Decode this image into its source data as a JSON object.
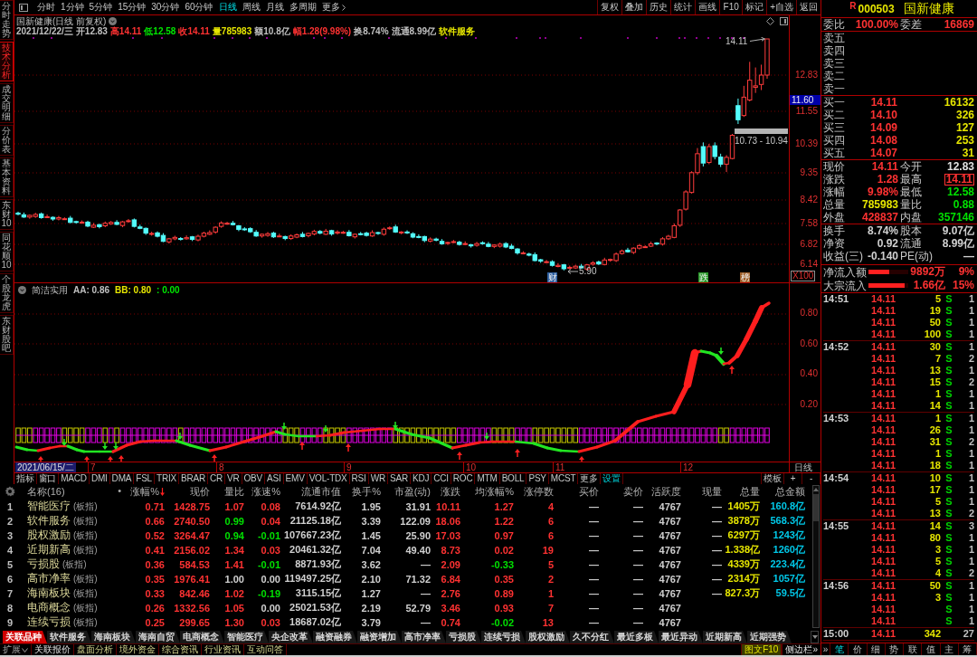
{
  "side_tabs": [
    {
      "label": "分时走势",
      "selected": false
    },
    {
      "label": "技术分析",
      "selected": true
    },
    {
      "label": "成交明细",
      "selected": false
    },
    {
      "label": "分价表",
      "selected": false
    },
    {
      "label": "基本资料",
      "selected": false
    },
    {
      "label": "东财10",
      "selected": false
    },
    {
      "label": "同花顺10",
      "selected": false
    },
    {
      "label": "个股龙虎",
      "selected": false
    },
    {
      "label": "东财股吧",
      "selected": false
    }
  ],
  "toolbar": {
    "periods": [
      {
        "label": "分时",
        "selected": false
      },
      {
        "label": "1分钟",
        "selected": false
      },
      {
        "label": "5分钟",
        "selected": false
      },
      {
        "label": "15分钟",
        "selected": false
      },
      {
        "label": "30分钟",
        "selected": false
      },
      {
        "label": "60分钟",
        "selected": false
      },
      {
        "label": "日线",
        "selected": true
      },
      {
        "label": "周线",
        "selected": false
      },
      {
        "label": "月线",
        "selected": false
      },
      {
        "label": "多周期",
        "selected": false
      }
    ],
    "more": "更多",
    "actions": [
      "复权",
      "叠加",
      "历史",
      "统计",
      "画线",
      "F10",
      "标记",
      "+自选",
      "返回"
    ]
  },
  "chart": {
    "title": "国新健康(日线 前复权)",
    "info": [
      {
        "text": "2021/12/22/三",
        "color": "#c0c0c0"
      },
      {
        "text": "开12.83",
        "color": "#c0c0c0"
      },
      {
        "text": "高14.11",
        "color": "#ff3232"
      },
      {
        "text": "低12.58",
        "color": "#00e600"
      },
      {
        "text": "收14.11",
        "color": "#ff3232"
      },
      {
        "text": "量785983",
        "color": "#e6e600"
      },
      {
        "text": "额10.8亿",
        "color": "#c0c0c0"
      },
      {
        "text": "幅1.28(9.98%)",
        "color": "#ff3232"
      },
      {
        "text": "换8.74%",
        "color": "#c0c0c0"
      },
      {
        "text": "流通8.99亿",
        "color": "#c0c0c0"
      },
      {
        "text": "软件服务",
        "color": "#e6e600"
      }
    ],
    "high_label": "14.11",
    "range_label": "10.73 - 10.94",
    "low_label": "5.90",
    "badges": [
      {
        "text": "财",
        "color": "#2d5fa0"
      },
      {
        "text": "跌",
        "color": "#2a9a2a"
      },
      {
        "text": "榜",
        "color": "#a0602a"
      }
    ],
    "price_axis": [
      "12.83",
      "11.55",
      "10.39",
      "9.35",
      "8.42",
      "7.58",
      "6.82",
      "6.14"
    ],
    "price_tag": "11.60",
    "scale": "X100"
  },
  "indicator": {
    "name": "简洁实用",
    "values": [
      {
        "text": "AA: 0.86",
        "color": "#c0c0c0"
      },
      {
        "text": "BB: 0.80",
        "color": "#e6e600"
      },
      {
        "text": ": 0.00",
        "color": "#00e600"
      }
    ],
    "axis": [
      "0.80",
      "0.60",
      "0.40",
      "0.20"
    ]
  },
  "time_axis": {
    "cursor_date": "2021/06/15/二",
    "months": [
      "7",
      "8",
      "9",
      "10",
      "11",
      "12"
    ],
    "period": "日线"
  },
  "indicator_tabs": {
    "tabs": [
      "指标",
      "窗口",
      "MACD",
      "DMI",
      "DMA",
      "FSL",
      "TRIX",
      "BRAR",
      "CR",
      "VR",
      "OBV",
      "ASI",
      "EMV",
      "VOL-TDX",
      "RSI",
      "WR",
      "SAR",
      "KDJ",
      "CCI",
      "ROC",
      "MTM",
      "BOLL",
      "PSY",
      "MCST"
    ],
    "more": "更多",
    "settings": "设置",
    "template": "模板",
    "zoom_in": "+",
    "zoom_out": "-"
  },
  "table": {
    "name_header": "名称(16)",
    "marker_header": "•",
    "columns": [
      {
        "label": "涨幅%",
        "sorted": true
      },
      {
        "label": "现价",
        "sorted": false
      },
      {
        "label": "量比",
        "sorted": false
      },
      {
        "label": "涨速%",
        "sorted": false
      },
      {
        "label": "流通市值",
        "sorted": false
      },
      {
        "label": "换手%",
        "sorted": false
      },
      {
        "label": "市盈(动)",
        "sorted": false
      },
      {
        "label": "涨跌",
        "sorted": false
      },
      {
        "label": "均涨幅%",
        "sorted": false
      },
      {
        "label": "涨停数",
        "sorted": false
      },
      {
        "label": "买价",
        "sorted": false
      },
      {
        "label": "卖价",
        "sorted": false
      },
      {
        "label": "活跃度",
        "sorted": false
      },
      {
        "label": "现量",
        "sorted": false
      },
      {
        "label": "总量",
        "sorted": false,
        "color": "#e6e600"
      },
      {
        "label": "总金额",
        "sorted": false,
        "color": "#00c8e8"
      }
    ],
    "rows": [
      {
        "index": "1",
        "name": "智能医疗",
        "tag": "(板指)",
        "cells": [
          {
            "text": "0.71",
            "color": "#ff3232"
          },
          {
            "text": "1428.75",
            "color": "#ff3232"
          },
          {
            "text": "1.07",
            "color": "#ff3232"
          },
          {
            "text": "0.08",
            "color": "#ff3232"
          },
          {
            "text": "7614.92亿"
          },
          {
            "text": "1.95"
          },
          {
            "text": "31.91"
          },
          {
            "text": "10.11",
            "color": "#ff3232"
          },
          {
            "text": "1.27",
            "color": "#ff3232"
          },
          {
            "text": "4",
            "color": "#ff3232"
          },
          {
            "text": "—"
          },
          {
            "text": "—"
          },
          {
            "text": "4767"
          },
          {
            "text": "—"
          },
          {
            "text": "1405万"
          },
          {
            "text": "160.8亿"
          }
        ]
      },
      {
        "index": "2",
        "name": "软件服务",
        "tag": "(板指)",
        "cells": [
          {
            "text": "0.66",
            "color": "#ff3232"
          },
          {
            "text": "2740.50",
            "color": "#ff3232"
          },
          {
            "text": "0.99",
            "color": "#00e000"
          },
          {
            "text": "0.04",
            "color": "#ff3232"
          },
          {
            "text": "21125.18亿"
          },
          {
            "text": "3.39"
          },
          {
            "text": "122.09"
          },
          {
            "text": "18.06",
            "color": "#ff3232"
          },
          {
            "text": "1.22",
            "color": "#ff3232"
          },
          {
            "text": "6",
            "color": "#ff3232"
          },
          {
            "text": "—"
          },
          {
            "text": "—"
          },
          {
            "text": "4767"
          },
          {
            "text": "—"
          },
          {
            "text": "3878万"
          },
          {
            "text": "568.3亿"
          }
        ]
      },
      {
        "index": "3",
        "name": "股权激励",
        "tag": "(板指)",
        "cells": [
          {
            "text": "0.52",
            "color": "#ff3232"
          },
          {
            "text": "3264.47",
            "color": "#ff3232"
          },
          {
            "text": "0.94",
            "color": "#00e000"
          },
          {
            "text": "-0.01",
            "color": "#00e000"
          },
          {
            "text": "107667.23亿"
          },
          {
            "text": "1.45"
          },
          {
            "text": "25.90"
          },
          {
            "text": "17.03",
            "color": "#ff3232"
          },
          {
            "text": "0.97",
            "color": "#ff3232"
          },
          {
            "text": "6",
            "color": "#ff3232"
          },
          {
            "text": "—"
          },
          {
            "text": "—"
          },
          {
            "text": "4767"
          },
          {
            "text": "—"
          },
          {
            "text": "6297万"
          },
          {
            "text": "1243亿"
          }
        ]
      },
      {
        "index": "4",
        "name": "近期新高",
        "tag": "(板指)",
        "cells": [
          {
            "text": "0.41",
            "color": "#ff3232"
          },
          {
            "text": "2156.02",
            "color": "#ff3232"
          },
          {
            "text": "1.34",
            "color": "#ff3232"
          },
          {
            "text": "0.03",
            "color": "#ff3232"
          },
          {
            "text": "20461.32亿"
          },
          {
            "text": "7.04"
          },
          {
            "text": "49.40"
          },
          {
            "text": "8.73",
            "color": "#ff3232"
          },
          {
            "text": "0.02",
            "color": "#ff3232"
          },
          {
            "text": "19",
            "color": "#ff3232"
          },
          {
            "text": "—"
          },
          {
            "text": "—"
          },
          {
            "text": "4767"
          },
          {
            "text": "—"
          },
          {
            "text": "1.338亿"
          },
          {
            "text": "1260亿"
          }
        ]
      },
      {
        "index": "5",
        "name": "亏损股",
        "tag": "(板指)",
        "cells": [
          {
            "text": "0.36",
            "color": "#ff3232"
          },
          {
            "text": "584.53",
            "color": "#ff3232"
          },
          {
            "text": "1.41",
            "color": "#ff3232"
          },
          {
            "text": "-0.01",
            "color": "#00e000"
          },
          {
            "text": "8871.93亿"
          },
          {
            "text": "3.62"
          },
          {
            "text": "—"
          },
          {
            "text": "2.09",
            "color": "#ff3232"
          },
          {
            "text": "-0.33",
            "color": "#00e000"
          },
          {
            "text": "5",
            "color": "#ff3232"
          },
          {
            "text": "—"
          },
          {
            "text": "—"
          },
          {
            "text": "4767"
          },
          {
            "text": "—"
          },
          {
            "text": "4339万"
          },
          {
            "text": "223.4亿"
          }
        ]
      },
      {
        "index": "6",
        "name": "高市净率",
        "tag": "(板指)",
        "cells": [
          {
            "text": "0.35",
            "color": "#ff3232"
          },
          {
            "text": "1976.41",
            "color": "#ff3232"
          },
          {
            "text": "1.00"
          },
          {
            "text": "0.00"
          },
          {
            "text": "119497.25亿"
          },
          {
            "text": "2.10"
          },
          {
            "text": "71.32"
          },
          {
            "text": "6.84",
            "color": "#ff3232"
          },
          {
            "text": "0.35",
            "color": "#ff3232"
          },
          {
            "text": "2",
            "color": "#ff3232"
          },
          {
            "text": "—"
          },
          {
            "text": "—"
          },
          {
            "text": "4767"
          },
          {
            "text": "—"
          },
          {
            "text": "2314万"
          },
          {
            "text": "1057亿"
          }
        ]
      },
      {
        "index": "7",
        "name": "海南板块",
        "tag": "(板指)",
        "cells": [
          {
            "text": "0.33",
            "color": "#ff3232"
          },
          {
            "text": "842.46",
            "color": "#ff3232"
          },
          {
            "text": "1.02",
            "color": "#ff3232"
          },
          {
            "text": "-0.19",
            "color": "#00e000"
          },
          {
            "text": "3115.15亿"
          },
          {
            "text": "1.27"
          },
          {
            "text": "—"
          },
          {
            "text": "2.76",
            "color": "#ff3232"
          },
          {
            "text": "0.89",
            "color": "#ff3232"
          },
          {
            "text": "1",
            "color": "#ff3232"
          },
          {
            "text": "—"
          },
          {
            "text": "—"
          },
          {
            "text": "4767"
          },
          {
            "text": "—"
          },
          {
            "text": "827.3万"
          },
          {
            "text": "59.5亿"
          }
        ]
      },
      {
        "index": "8",
        "name": "电商概念",
        "tag": "(板指)",
        "cells": [
          {
            "text": "0.26",
            "color": "#ff3232"
          },
          {
            "text": "1332.56",
            "color": "#ff3232"
          },
          {
            "text": "1.05",
            "color": "#ff3232"
          },
          {
            "text": "0.00"
          },
          {
            "text": "25021.53亿"
          },
          {
            "text": "2.19"
          },
          {
            "text": "52.79"
          },
          {
            "text": "3.46",
            "color": "#ff3232"
          },
          {
            "text": "0.93",
            "color": "#ff3232"
          },
          {
            "text": "7",
            "color": "#ff3232"
          },
          {
            "text": "—"
          },
          {
            "text": "—"
          },
          {
            "text": "4767"
          }
        ]
      },
      {
        "index": "9",
        "name": "连续亏损",
        "tag": "(板指)",
        "cells": [
          {
            "text": "0.25",
            "color": "#ff3232"
          },
          {
            "text": "299.65",
            "color": "#ff3232"
          },
          {
            "text": "1.30",
            "color": "#ff3232"
          },
          {
            "text": "0.03",
            "color": "#ff3232"
          },
          {
            "text": "18687.02亿"
          },
          {
            "text": "3.79"
          },
          {
            "text": "—"
          },
          {
            "text": "0.74",
            "color": "#ff3232"
          },
          {
            "text": "-0.02",
            "color": "#00e000"
          },
          {
            "text": "13",
            "color": "#ff3232"
          },
          {
            "text": "—"
          },
          {
            "text": "—"
          },
          {
            "text": "4767"
          }
        ]
      }
    ]
  },
  "section_tabs": [
    {
      "label": "关联品种",
      "selected": true
    },
    {
      "label": "软件服务",
      "selected": false
    },
    {
      "label": "海南板块",
      "selected": false
    },
    {
      "label": "海南自贸",
      "selected": false
    },
    {
      "label": "电商概念",
      "selected": false
    },
    {
      "label": "智能医疗",
      "selected": false
    },
    {
      "label": "央企改革",
      "selected": false
    },
    {
      "label": "融资融券",
      "selected": false
    },
    {
      "label": "融资增加",
      "selected": false
    },
    {
      "label": "高市净率",
      "selected": false
    },
    {
      "label": "亏损股",
      "selected": false
    },
    {
      "label": "连续亏损",
      "selected": false
    },
    {
      "label": "股权激励",
      "selected": false
    },
    {
      "label": "久不分红",
      "selected": false
    },
    {
      "label": "最近多板",
      "selected": false
    },
    {
      "label": "最近异动",
      "selected": false
    },
    {
      "label": "近期新高",
      "selected": false
    },
    {
      "label": "近期强势",
      "selected": false
    }
  ],
  "status_bar": {
    "expand": "扩展",
    "links": [
      {
        "label": "关联报价",
        "selected": true
      },
      {
        "label": "盘面分析",
        "selected": false
      },
      {
        "label": "境外资金",
        "selected": false
      },
      {
        "label": "综合资讯",
        "selected": false
      },
      {
        "label": "行业资讯",
        "selected": false
      },
      {
        "label": "互动问答",
        "selected": false
      }
    ],
    "buttons": [
      {
        "label": "图文F10",
        "kind": "highlight"
      },
      {
        "label": "侧边栏»",
        "kind": "plain"
      }
    ]
  },
  "quote": {
    "flag": "R",
    "code": "000503",
    "name": "国新健康",
    "ratio": [
      {
        "label": "委比",
        "value": "100.00%",
        "color": "#ff3232"
      },
      {
        "label": "委差",
        "value": "16869",
        "color": "#ff3232"
      }
    ],
    "asks": [
      "卖五",
      "卖四",
      "卖三",
      "卖二",
      "卖一"
    ],
    "bids": [
      {
        "label": "买一",
        "price": "14.11",
        "volume": "16132"
      },
      {
        "label": "买二",
        "price": "14.10",
        "volume": "326"
      },
      {
        "label": "买三",
        "price": "14.09",
        "volume": "127"
      },
      {
        "label": "买四",
        "price": "14.08",
        "volume": "253"
      },
      {
        "label": "买五",
        "price": "14.07",
        "volume": "31"
      }
    ],
    "stats": [
      {
        "label": "现价",
        "value": "14.11",
        "color": "#ff3232",
        "boxed": false
      },
      {
        "label": "今开",
        "value": "12.83",
        "color": "#e0e0e0",
        "boxed": false
      },
      {
        "label": "涨跌",
        "value": "1.28",
        "color": "#ff3232",
        "boxed": false
      },
      {
        "label": "最高",
        "value": "14.11",
        "color": "#ff3232",
        "boxed": true
      },
      {
        "label": "涨幅",
        "value": "9.98%",
        "color": "#ff3232",
        "boxed": false
      },
      {
        "label": "最低",
        "value": "12.58",
        "color": "#00e000",
        "boxed": false
      },
      {
        "label": "总量",
        "value": "785983",
        "color": "#e6e600",
        "boxed": false
      },
      {
        "label": "量比",
        "value": "0.88",
        "color": "#00e000",
        "boxed": false
      },
      {
        "label": "外盘",
        "value": "428837",
        "color": "#ff3232",
        "boxed": false
      },
      {
        "label": "内盘",
        "value": "357146",
        "color": "#00e000",
        "boxed": false
      }
    ],
    "fundamentals": [
      {
        "label": "换手",
        "value": "8.74%"
      },
      {
        "label": "股本",
        "value": "9.07亿"
      },
      {
        "label": "净资",
        "value": "0.92"
      },
      {
        "label": "流通",
        "value": "8.99亿"
      },
      {
        "label": "收益(三)",
        "value": "-0.140"
      },
      {
        "label": "PE(动)",
        "value": "—"
      }
    ],
    "flows": [
      {
        "label": "净流入额",
        "level": 0.52,
        "value": "9892万",
        "share": "9%"
      },
      {
        "label": "大宗流入",
        "level": 0.9,
        "value": "1.66亿",
        "share": "15%"
      }
    ],
    "trades": [
      {
        "time": "14:51",
        "rows": [
          {
            "price": "14.11",
            "volume": "5",
            "side": "S",
            "count": "1"
          },
          {
            "price": "14.11",
            "volume": "19",
            "side": "S",
            "count": "1"
          },
          {
            "price": "14.11",
            "volume": "50",
            "side": "S",
            "count": "1"
          },
          {
            "price": "14.11",
            "volume": "100",
            "side": "S",
            "count": "1"
          }
        ]
      },
      {
        "time": "14:52",
        "rows": [
          {
            "price": "14.11",
            "volume": "30",
            "side": "S",
            "count": "1"
          },
          {
            "price": "14.11",
            "volume": "7",
            "side": "S",
            "count": "2"
          },
          {
            "price": "14.11",
            "volume": "13",
            "side": "S",
            "count": "1"
          },
          {
            "price": "14.11",
            "volume": "15",
            "side": "S",
            "count": "2"
          },
          {
            "price": "14.11",
            "volume": "1",
            "side": "S",
            "count": "1"
          },
          {
            "price": "14.11",
            "volume": "14",
            "side": "S",
            "count": "1"
          }
        ]
      },
      {
        "time": "14:53",
        "rows": [
          {
            "price": "14.11",
            "volume": "1",
            "side": "S",
            "count": "1"
          },
          {
            "price": "14.11",
            "volume": "26",
            "side": "S",
            "count": "1"
          },
          {
            "price": "14.11",
            "volume": "31",
            "side": "S",
            "count": "2"
          },
          {
            "price": "14.11",
            "volume": "1",
            "side": "S",
            "count": "1"
          },
          {
            "price": "14.11",
            "volume": "18",
            "side": "S",
            "count": "1"
          }
        ]
      },
      {
        "time": "14:54",
        "rows": [
          {
            "price": "14.11",
            "volume": "10",
            "side": "S",
            "count": "1"
          },
          {
            "price": "14.11",
            "volume": "17",
            "side": "S",
            "count": "1"
          },
          {
            "price": "14.11",
            "volume": "5",
            "side": "S",
            "count": "1"
          },
          {
            "price": "14.11",
            "volume": "13",
            "side": "S",
            "count": "2"
          }
        ]
      },
      {
        "time": "14:55",
        "rows": [
          {
            "price": "14.11",
            "volume": "14",
            "side": "S",
            "count": "3"
          },
          {
            "price": "14.11",
            "volume": "80",
            "side": "S",
            "count": "1"
          },
          {
            "price": "14.11",
            "volume": "3",
            "side": "S",
            "count": "1"
          },
          {
            "price": "14.11",
            "volume": "5",
            "side": "S",
            "count": "1"
          },
          {
            "price": "14.11",
            "volume": "4",
            "side": "S",
            "count": "2"
          }
        ]
      },
      {
        "time": "14:56",
        "rows": [
          {
            "price": "14.11",
            "volume": "50",
            "side": "S",
            "count": "1"
          },
          {
            "price": "14.11",
            "volume": "3",
            "side": "S",
            "count": "1"
          },
          {
            "price": "14.11",
            "side": "S",
            "count": "1"
          },
          {
            "price": "14.11",
            "side": "S",
            "count": "1"
          }
        ]
      },
      {
        "time": "15:00",
        "rows": [
          {
            "price": "14.11",
            "volume": "342",
            "count": "27"
          }
        ]
      }
    ],
    "tabs_more": "»",
    "tabs": [
      {
        "label": "笔",
        "selected": true
      },
      {
        "label": "价",
        "selected": false
      },
      {
        "label": "细",
        "selected": false
      },
      {
        "label": "势",
        "selected": false
      },
      {
        "label": "联",
        "selected": false
      },
      {
        "label": "值",
        "selected": false
      },
      {
        "label": "主",
        "selected": false
      },
      {
        "label": "筹",
        "selected": false
      }
    ]
  }
}
